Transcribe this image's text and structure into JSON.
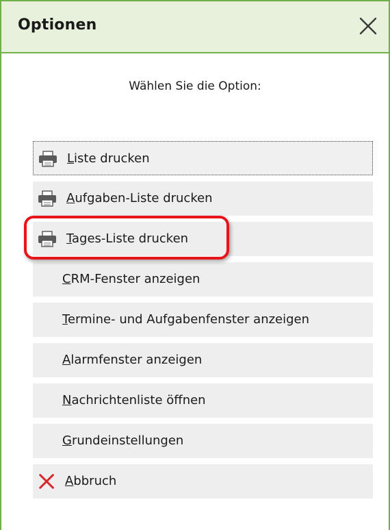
{
  "window": {
    "title": "Optionen",
    "close_icon": "close-icon"
  },
  "prompt": "Wählen Sie die Option:",
  "options": [
    {
      "icon": "printer-icon",
      "first_letter": "L",
      "rest": "iste drucken",
      "label": "Liste drucken"
    },
    {
      "icon": "printer-icon",
      "first_letter": "A",
      "rest": "ufgaben-Liste drucken",
      "label": "Aufgaben-Liste drucken"
    },
    {
      "icon": "printer-icon",
      "first_letter": "T",
      "rest": "ages-Liste drucken",
      "label": "Tages-Liste drucken"
    },
    {
      "icon": "",
      "first_letter": "C",
      "rest": "RM-Fenster anzeigen",
      "label": "CRM-Fenster anzeigen"
    },
    {
      "icon": "",
      "first_letter": "T",
      "rest": "ermine- und Aufgabenfenster anzeigen",
      "label": "Termine- und Aufgabenfenster anzeigen"
    },
    {
      "icon": "",
      "first_letter": "A",
      "rest": "larmfenster anzeigen",
      "label": "Alarmfenster anzeigen"
    },
    {
      "icon": "",
      "first_letter": "N",
      "rest": "achrichtenliste öffnen",
      "label": "Nachrichtenliste öffnen"
    },
    {
      "icon": "",
      "first_letter": "G",
      "rest": "rundeinstellungen",
      "label": "Grundeinstellungen"
    },
    {
      "icon": "cancel-x-icon",
      "first_letter": "A",
      "rest": "bbruch",
      "label": "Abbruch"
    }
  ],
  "colors": {
    "border": "#6fb04a",
    "titlebar_bg": "#e8f1dc",
    "option_bg": "#eeeeee",
    "highlight": "#e8141c",
    "cancel_x": "#d9262c"
  }
}
